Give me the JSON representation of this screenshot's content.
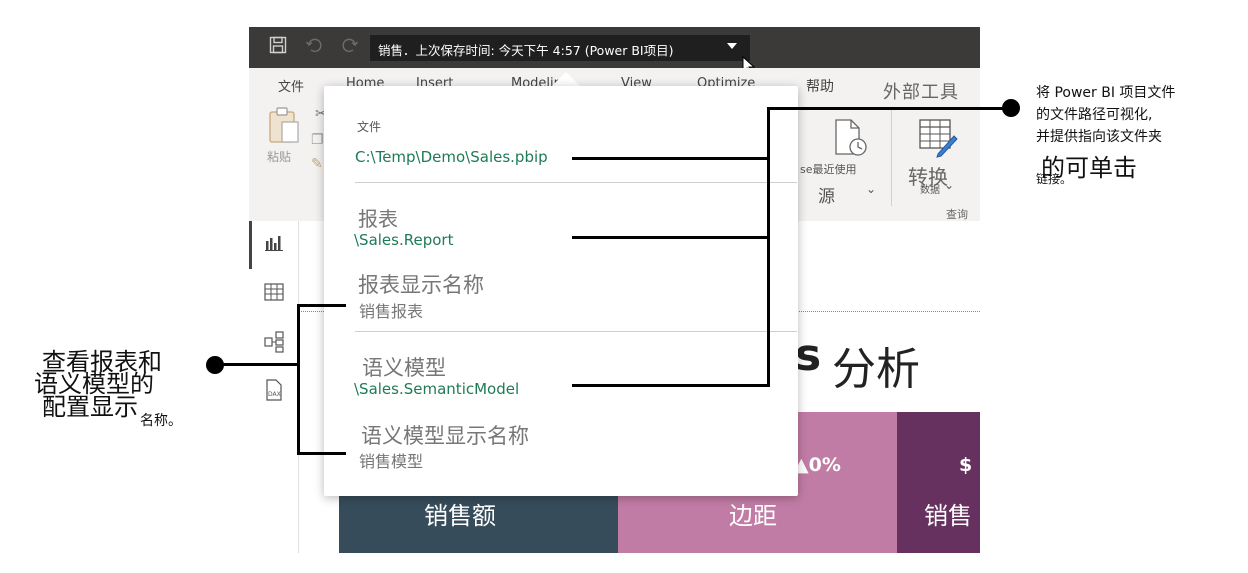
{
  "titlebar": {
    "title": "销售．上次保存时间: 今天下午 4:57 (Power BI项目)"
  },
  "ribbon": {
    "tabs": [
      "文件",
      "Home",
      "Insert",
      "Modeling",
      "View",
      "Optimize",
      "帮助",
      "外部工具"
    ],
    "paste_label": "粘贴",
    "recent_sources_label": "se最近使用",
    "recent_sources_sub": "源",
    "transform_label": "转换",
    "transform_sub": "数据",
    "queries_group": "查询"
  },
  "panel": {
    "file_caption": "文件",
    "file_path": "C:\\Temp\\Demo\\Sales.pbip",
    "report_caption": "报表",
    "report_path": "\\Sales.Report",
    "report_display_caption": "报表显示名称",
    "report_display_name": "销售报表",
    "model_caption": "语义模型",
    "model_path": "\\Sales.SemanticModel",
    "model_display_caption": "语义模型显示名称",
    "model_display_name": "销售模型"
  },
  "canvas": {
    "heading_partial": "s",
    "heading": "分析",
    "cards": [
      {
        "label": "销售额",
        "value": ""
      },
      {
        "label": "边距",
        "value": "▲0%"
      },
      {
        "label": "销售",
        "value": "$"
      }
    ]
  },
  "callouts": {
    "right_line1": "将 Power BI 项目文件",
    "right_line2": "的文件路径可视化,",
    "right_line3": "并提供指向该文件夹",
    "right_line4": "的可单击",
    "right_line5": "链接。",
    "left_line1": "查看报表和",
    "left_line2": "语义模型的",
    "left_line3": "配置显示",
    "left_line4": "名称。"
  }
}
